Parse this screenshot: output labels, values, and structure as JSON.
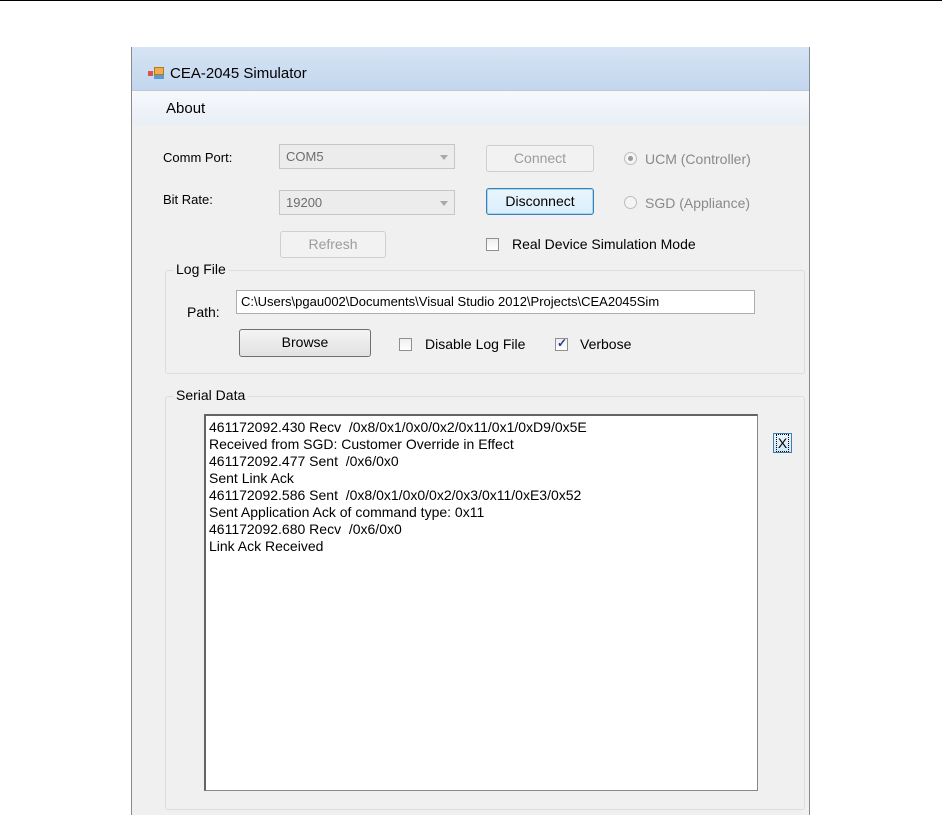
{
  "window": {
    "title": "CEA-2045 Simulator",
    "icon": "app-window-icon"
  },
  "menu": {
    "items": [
      "About"
    ]
  },
  "connection": {
    "comm_port_label": "Comm Port:",
    "comm_port_value": "COM5",
    "bit_rate_label": "Bit Rate:",
    "bit_rate_value": "19200",
    "connect_label": "Connect",
    "disconnect_label": "Disconnect",
    "refresh_label": "Refresh",
    "ucm_label": "UCM (Controller)",
    "ucm_selected": true,
    "sgd_label": "SGD (Appliance)",
    "sgd_selected": false,
    "real_device_label": "Real Device Simulation Mode",
    "real_device_checked": false
  },
  "log_file": {
    "group_title": "Log File",
    "path_label": "Path:",
    "path_value": "C:\\Users\\pgau002\\Documents\\Visual Studio 2012\\Projects\\CEA2045Sim",
    "browse_label": "Browse",
    "disable_label": "Disable Log File",
    "disable_checked": false,
    "verbose_label": "Verbose",
    "verbose_checked": true
  },
  "serial": {
    "group_title": "Serial Data",
    "clear_label": "X",
    "lines": [
      "461172092.430 Recv  /0x8/0x1/0x0/0x2/0x11/0x1/0xD9/0x5E",
      "Received from SGD: Customer Override in Effect",
      "461172092.477 Sent  /0x6/0x0",
      "Sent Link Ack",
      "461172092.586 Sent  /0x8/0x1/0x0/0x2/0x3/0x11/0xE3/0x52",
      "Sent Application Ack of command type: 0x11",
      "461172092.680 Recv  /0x6/0x0",
      "Link Ack Received"
    ]
  },
  "colors": {
    "titlebar": "#c3d6ee",
    "window_bg": "#f0f0f0",
    "check_mark": "#23398c"
  }
}
